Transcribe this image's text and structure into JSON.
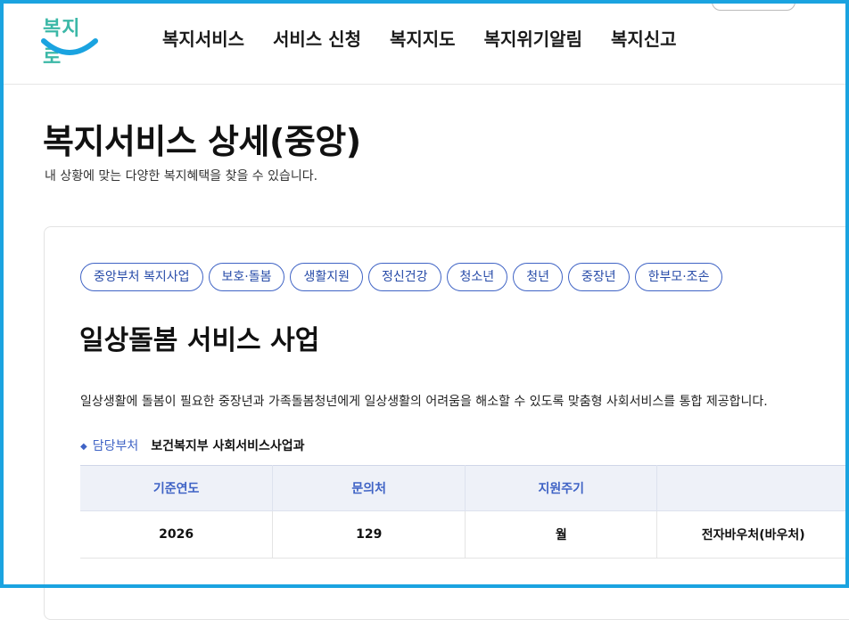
{
  "header": {
    "logo": "복지로",
    "nav": [
      "복지서비스",
      "서비스 신청",
      "복지지도",
      "복지위기알림",
      "복지신고"
    ]
  },
  "page": {
    "title": "복지서비스 상세(중앙)",
    "subtitle": "내 상황에 맞는 다양한 복지혜택을 찾을 수 있습니다."
  },
  "service": {
    "tags": [
      "중앙부처 복지사업",
      "보호·돌봄",
      "생활지원",
      "정신건강",
      "청소년",
      "청년",
      "중장년",
      "한부모·조손"
    ],
    "title": "일상돌봄 서비스 사업",
    "description": "일상생활에 돌봄이 필요한 중장년과 가족돌봄청년에게 일상생활의 어려움을 해소할 수 있도록 맞춤형 사회서비스를 통합 제공합니다.",
    "department_label": "담당부처",
    "department_value": "보건복지부 사회서비스사업과"
  },
  "table": {
    "headers": [
      "기준연도",
      "문의처",
      "지원주기",
      ""
    ],
    "row": [
      "2026",
      "129",
      "월",
      "전자바우처(바우처)"
    ]
  },
  "colors": {
    "accent": "#3f63c5",
    "frame": "#1aa3e0",
    "logo": "#3cb8a7",
    "logo_smile": "#1aa3e0"
  }
}
